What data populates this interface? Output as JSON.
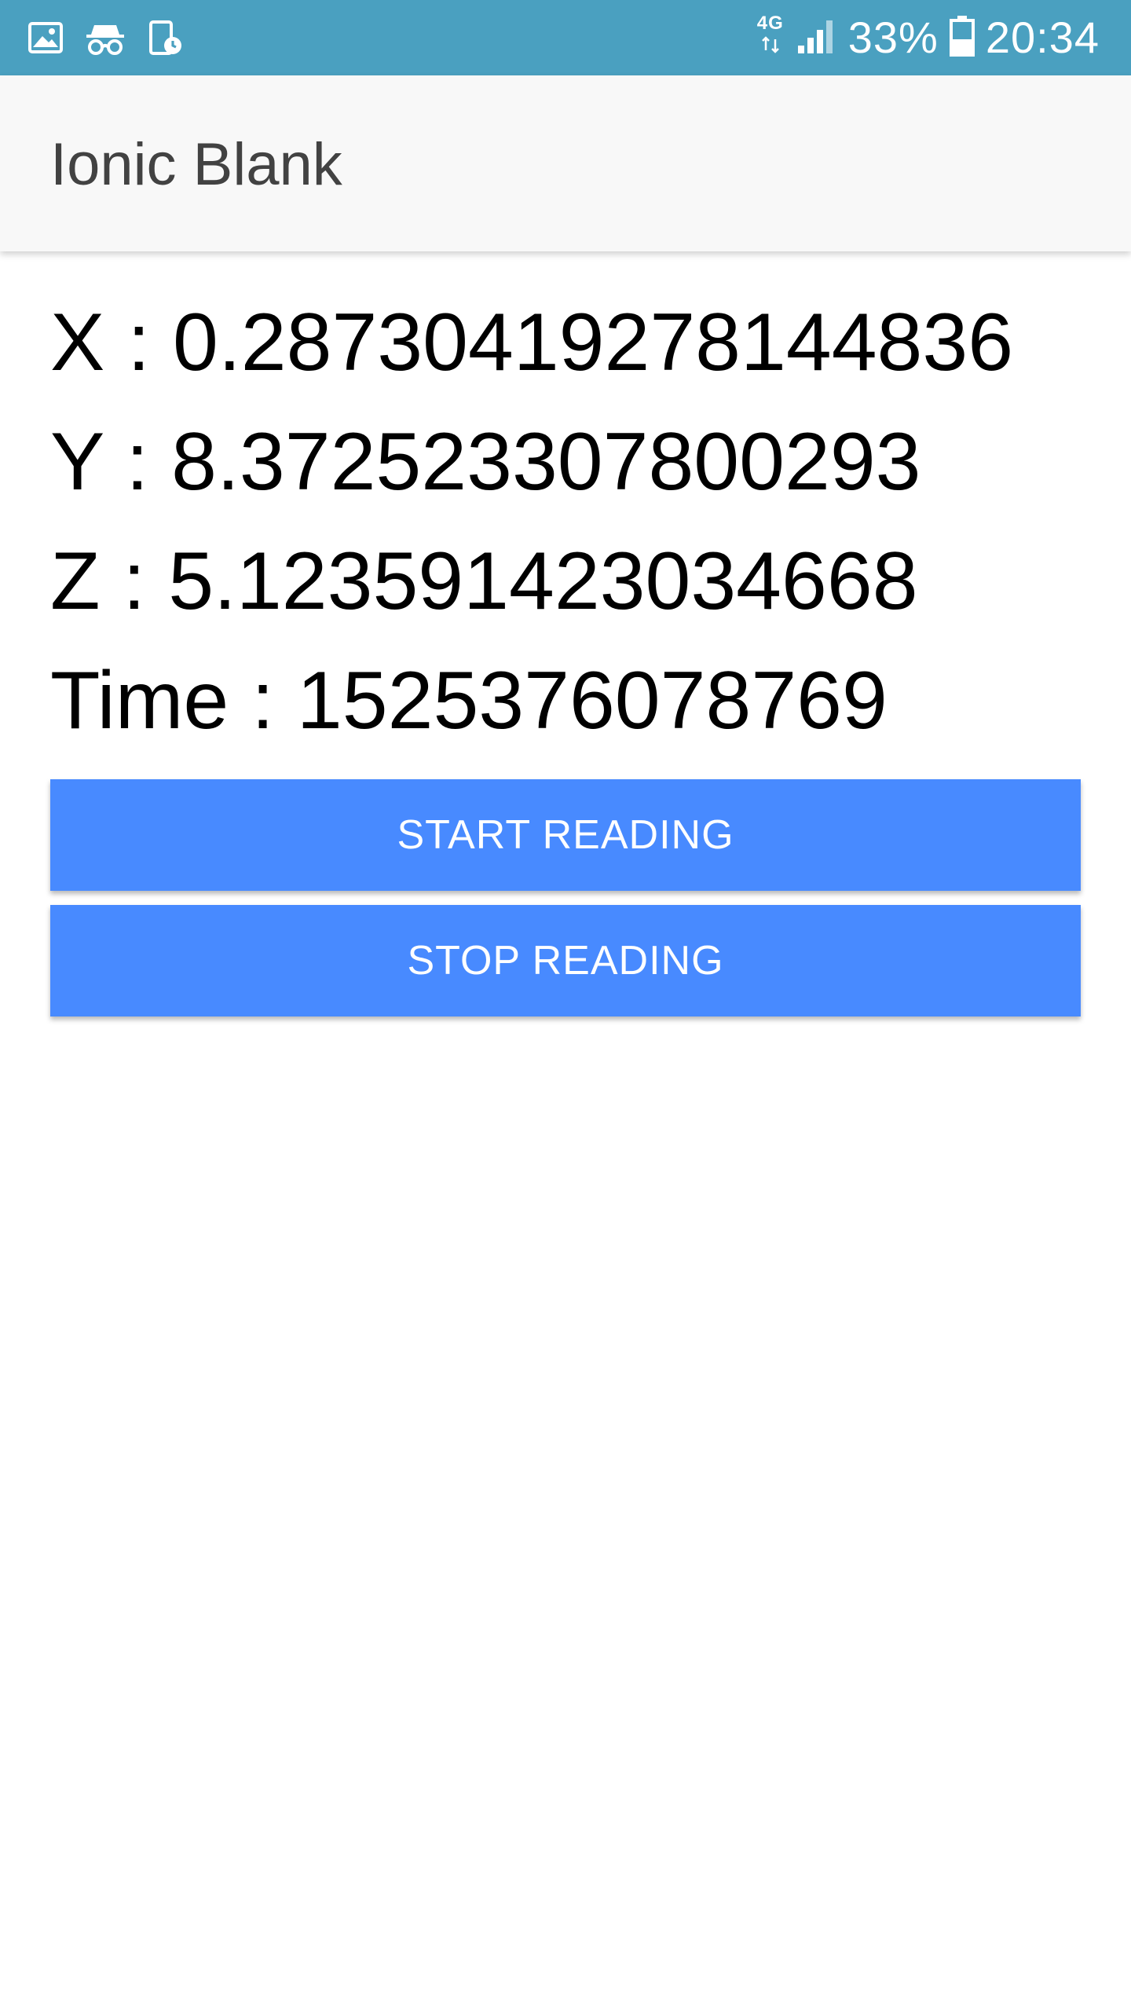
{
  "status_bar": {
    "left_icons": [
      "gallery-icon",
      "incognito-icon",
      "screen-timer-icon"
    ],
    "network_label": "4G",
    "battery": "33%",
    "time": "20:34",
    "background_color": "#4aa0c0"
  },
  "header": {
    "title": "Ionic Blank",
    "background_color": "#f8f8f8"
  },
  "readings": {
    "x": "X : 0.28730419278144836",
    "y": "Y : 8.372523307800293",
    "z": "Z : 5.123591423034668",
    "time": "Time : 1525376078769"
  },
  "buttons": {
    "start_label": "START READING",
    "stop_label": "STOP READING",
    "color": "#488aff"
  }
}
